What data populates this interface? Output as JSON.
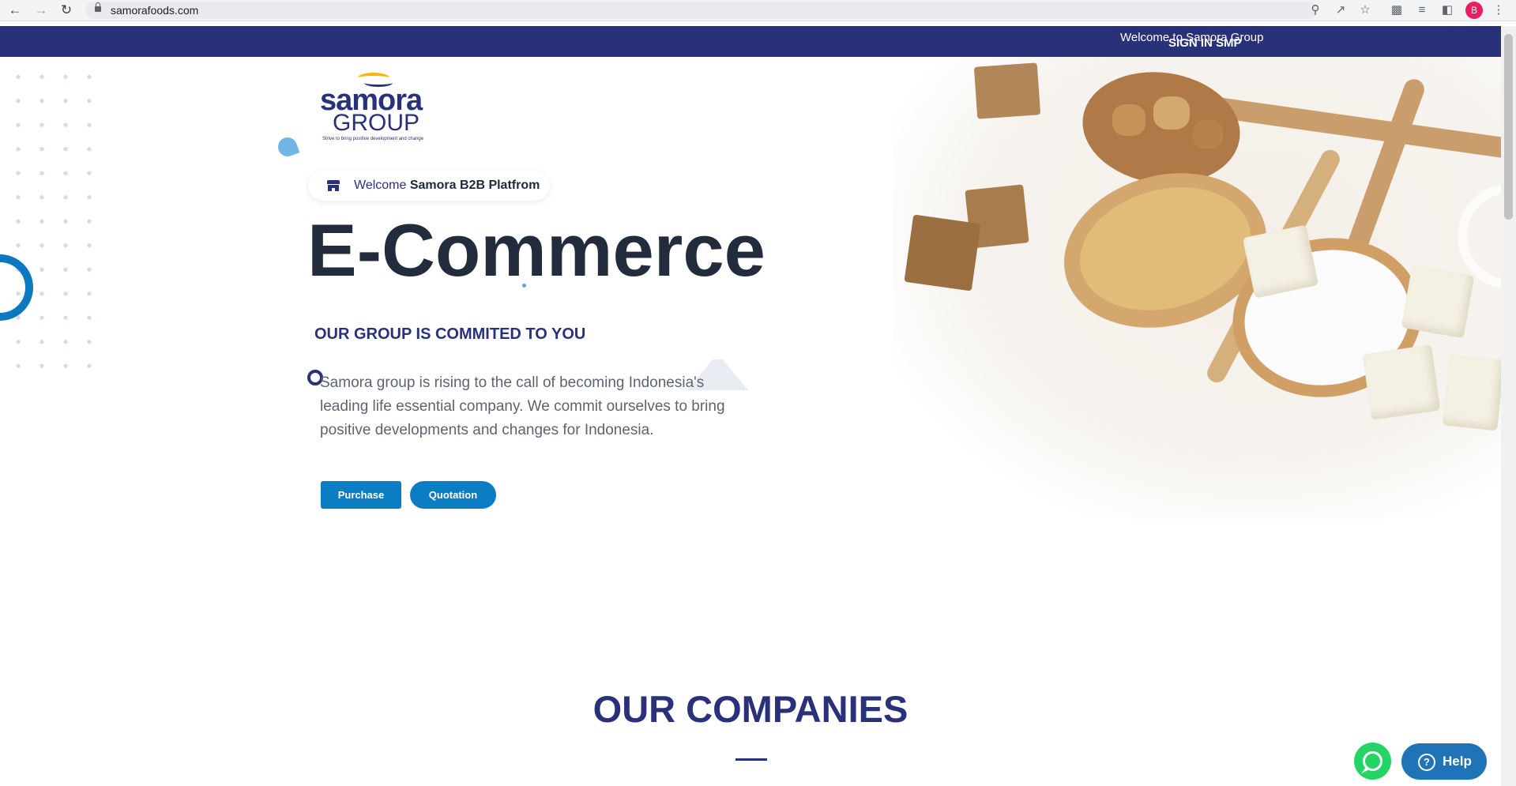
{
  "browser": {
    "url": "samorafoods.com",
    "avatar_initial": "B"
  },
  "topbar": {
    "welcome_text": "Welcome to Samora Group",
    "signin_text": "SIGN IN SMP"
  },
  "logo": {
    "word1": "samora",
    "word2": "GROUP",
    "tagline": "Strive to bring positive development and change"
  },
  "hero": {
    "welcome_prefix": "Welcome",
    "welcome_strong": "Samora B2B Platfrom",
    "headline": "E-Commerce",
    "subheading": "OUR GROUP IS COMMITED TO YOU",
    "description": "Samora group is rising to the call of becoming Indonesia's leading life essential company. We commit ourselves to bring positive developments and changes for Indonesia.",
    "purchase_label": "Purchase",
    "quotation_label": "Quotation"
  },
  "companies": {
    "title": "OUR COMPANIES"
  },
  "widgets": {
    "help_label": "Help"
  },
  "colors": {
    "brand_navy": "#29317b",
    "button_blue": "#0b7dc3",
    "whatsapp_green": "#25d366",
    "help_blue": "#1f73b7"
  },
  "icons": {
    "back": "arrow-left-icon",
    "forward": "arrow-right-icon",
    "reload": "reload-icon",
    "lock": "lock-icon",
    "key": "key-icon",
    "share": "share-icon",
    "star": "star-icon",
    "extensions": "puzzle-icon",
    "reading_list": "reading-list-icon",
    "sidepanel": "side-panel-icon",
    "menu": "kebab-menu-icon",
    "store": "store-icon",
    "whatsapp": "whatsapp-icon",
    "help": "question-icon"
  }
}
